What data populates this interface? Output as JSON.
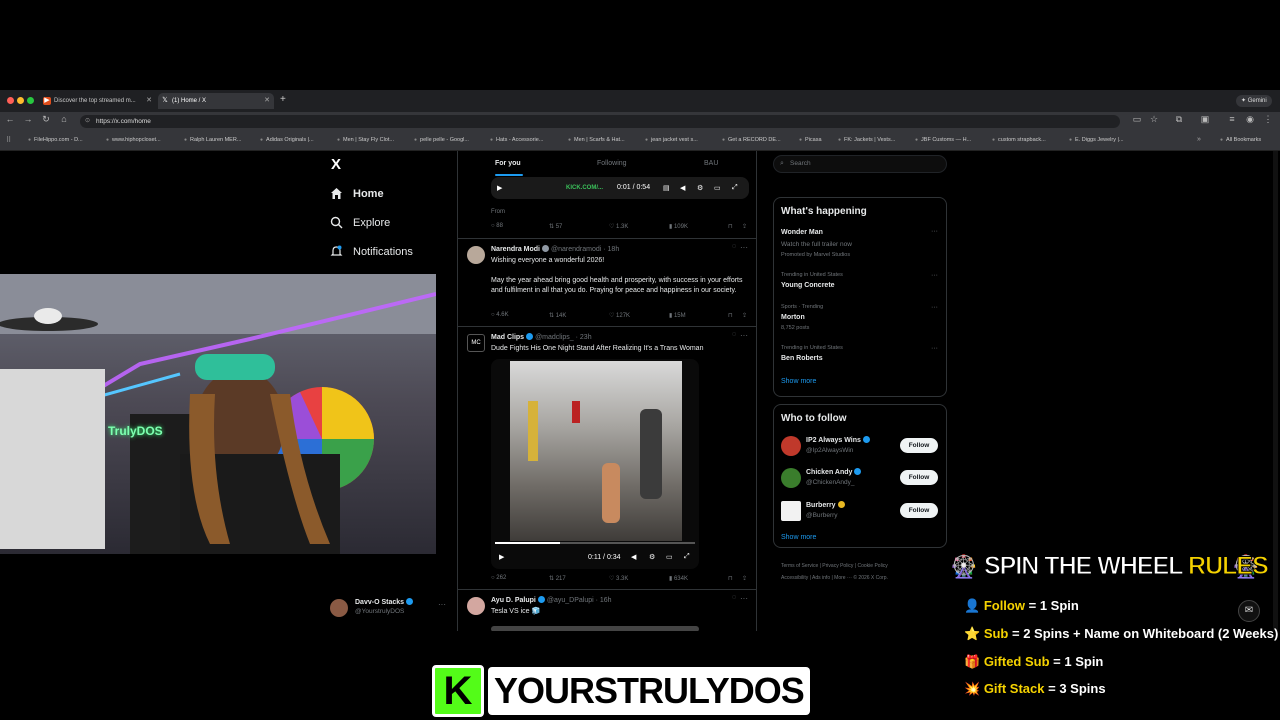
{
  "browser": {
    "tabs": [
      {
        "label": "Discover the top streamed m...",
        "active": false
      },
      {
        "label": "(1) Home / X",
        "active": true
      }
    ],
    "new_tab": "+",
    "gemini": "Gemini",
    "url": "https://x.com/home",
    "bookmarks": [
      "FileHippo.com - D...",
      "www.hiphopcloset...",
      "Ralph Lauren MER...",
      "Adidas Originals |...",
      "Men | Stay Fly Clot...",
      "pelle pelle - Googl...",
      "Hats - Accessorie...",
      "Men | Scarfs & Hat...",
      "jean jacket vest s...",
      "Get a RECORD DE...",
      "Picasa",
      "FK: Jackets | Vests...",
      "JBF Customs — H...",
      "custom strapback...",
      "E. Diggs Jewelry |..."
    ],
    "all_bookmarks": "All Bookmarks"
  },
  "nav": {
    "logo": "X",
    "items": [
      "Home",
      "Explore",
      "Notifications"
    ],
    "account": {
      "name": "Davv-O Stacks",
      "handle": "@YourstrulyDOS"
    }
  },
  "feed": {
    "tabs": [
      "For you",
      "Following",
      "BAU"
    ],
    "top_video": {
      "time": "0:01 / 0:54",
      "watermark": "KICK.COM/...",
      "from": "From"
    },
    "top_actions": [
      "88",
      "57",
      "1.3K",
      "109K"
    ],
    "posts": [
      {
        "name": "Narendra Modi",
        "handle": "@narendramodi · 18h",
        "text1": "Wishing everyone a wonderful 2026!",
        "text2": "May the year ahead bring good health and prosperity, with success in your efforts and fulfilment in all that you do. Praying for peace and happiness in our society.",
        "actions": [
          "4.6K",
          "14K",
          "127K",
          "15M"
        ]
      },
      {
        "name": "Mad Clips",
        "handle": "@madclips_ · 23h",
        "text1": "Dude Fights His One Night Stand After Realizing It's a Trans Woman",
        "video_time": "0:11 / 0:34",
        "actions": [
          "262",
          "217",
          "3.3K",
          "634K"
        ]
      },
      {
        "name": "Ayu D. Palupi",
        "handle": "@ayu_DPalupi · 16h",
        "text1": "Tesla VS ice 🧊"
      }
    ]
  },
  "sidebar": {
    "search_placeholder": "Search",
    "happening_title": "What's happening",
    "trends": [
      {
        "meta": "Watch the full trailer now",
        "name": "Wonder Man",
        "promo": "Promoted by Marvel Studios"
      },
      {
        "meta": "Trending in United States",
        "name": "Young Concrete"
      },
      {
        "meta": "Sports · Trending",
        "name": "Morton",
        "extra": "8,752 posts"
      },
      {
        "meta": "Trending in United States",
        "name": "Ben Roberts"
      }
    ],
    "show_more": "Show more",
    "wtf_title": "Who to follow",
    "wtf": [
      {
        "name": "IP2 Always Wins",
        "handle": "@Ip2AlwaysWin",
        "color": "#c0392b"
      },
      {
        "name": "Chicken Andy",
        "handle": "@ChickenAndy_",
        "color": "#3a7d2c"
      },
      {
        "name": "Burberry",
        "handle": "@Burberry",
        "color": "#f2f2f2"
      }
    ],
    "follow_label": "Follow",
    "footer1": "Terms of Service  |  Privacy Policy  |  Cookie Policy",
    "footer2": "Accessibility  |  Ads info  |  More ···  © 2026 X Corp."
  },
  "overlay": {
    "rules_title_a": "SPIN THE WHEEL ",
    "rules_title_b": "RULES",
    "rules": [
      {
        "key": "Follow",
        "val": "1 Spin",
        "icon": "👤"
      },
      {
        "key": "Sub",
        "val": "2 Spins + Name on Whiteboard (2 Weeks)",
        "icon": "⭐"
      },
      {
        "key": "Gifted Sub",
        "val": "1 Spin",
        "icon": "🎁"
      },
      {
        "key": "Gift Stack",
        "val": "3 Spins",
        "icon": "💥"
      }
    ],
    "brand_logo": "K",
    "brand_name": "YOURSTRULYDOS",
    "webcam_sign": "TrulyDOS"
  }
}
